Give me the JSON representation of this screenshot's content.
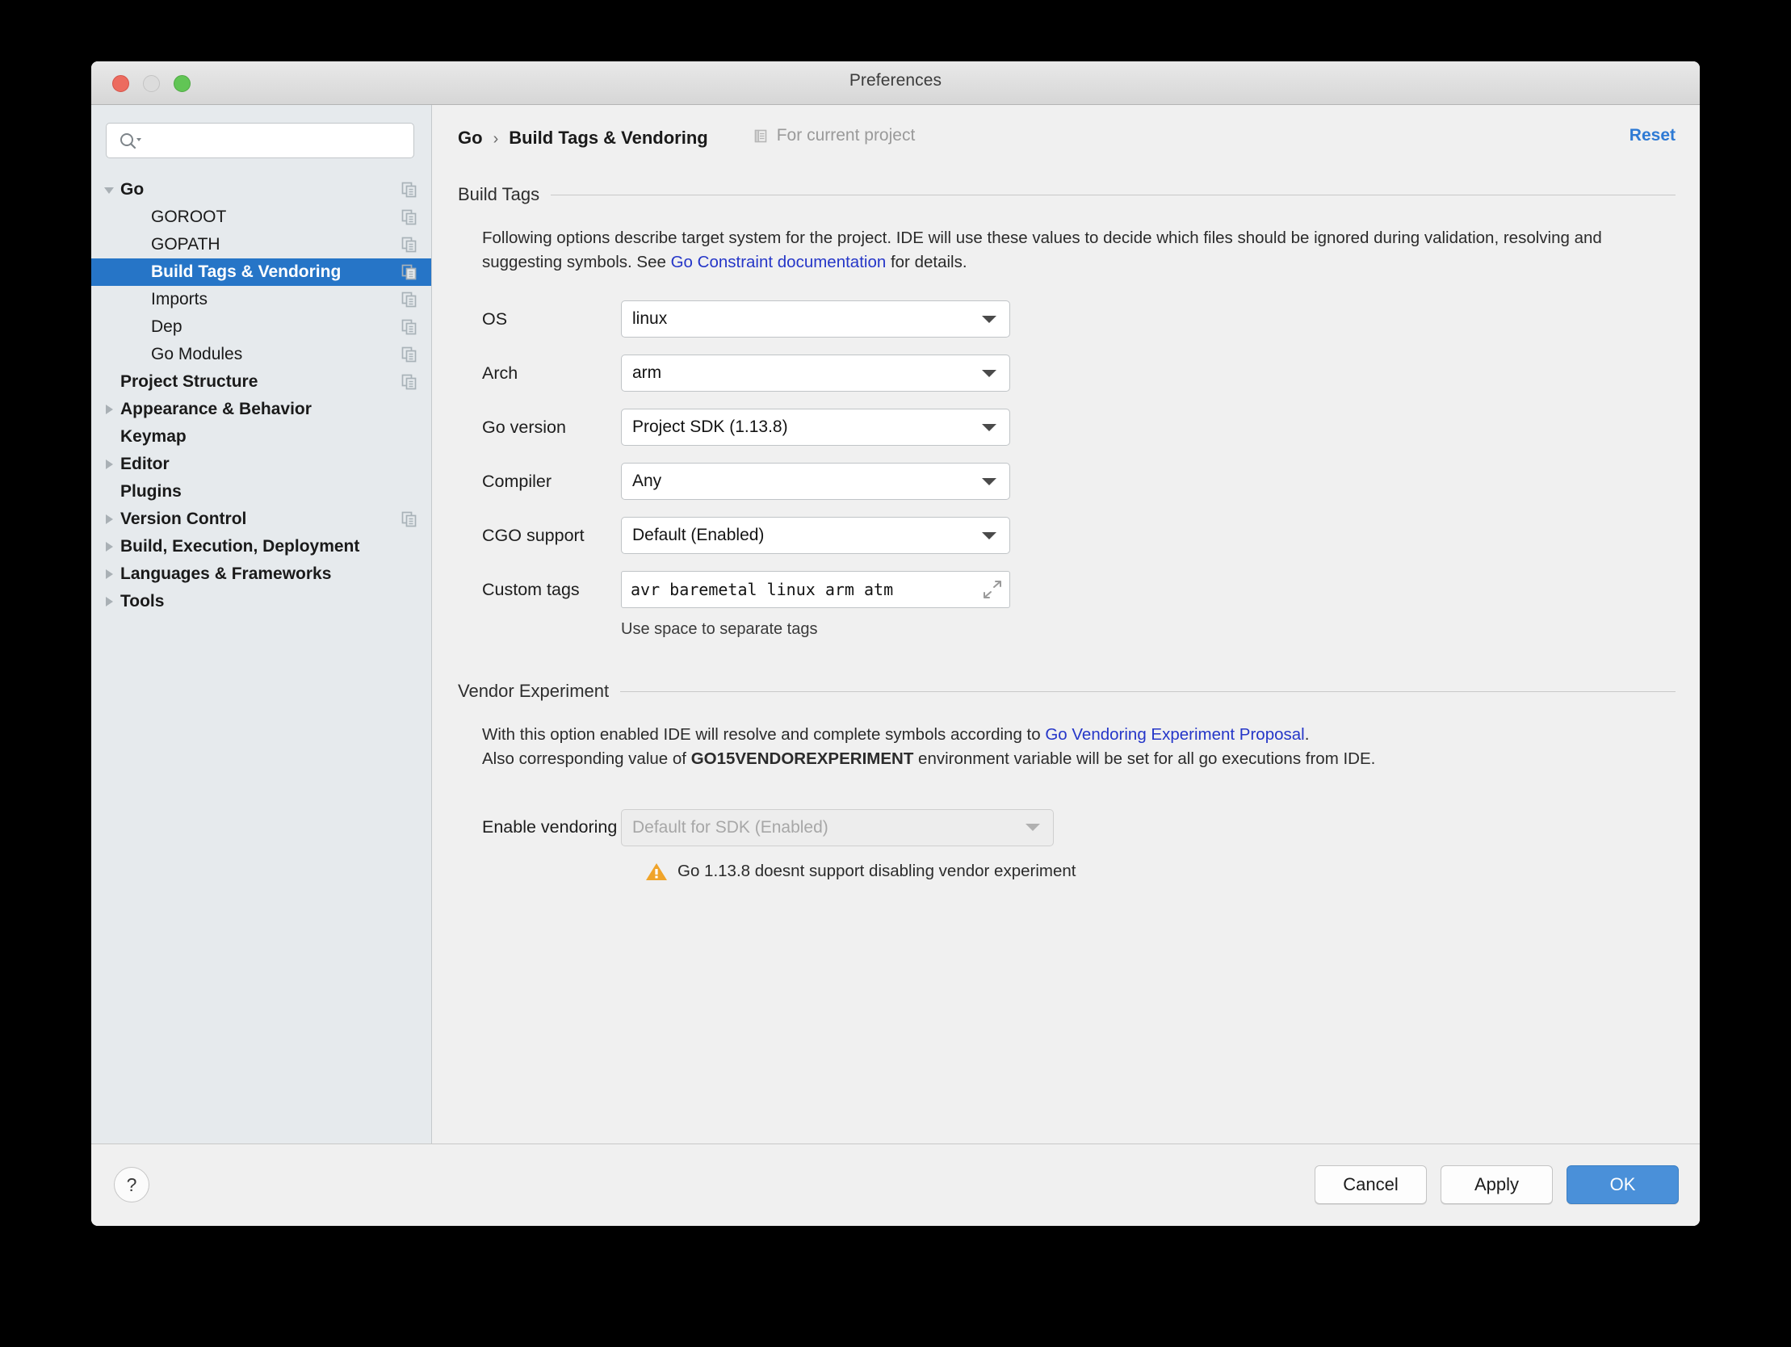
{
  "window": {
    "title": "Preferences",
    "traffic_lights": [
      "close",
      "minimize",
      "zoom"
    ]
  },
  "sidebar": {
    "search": {
      "placeholder": "",
      "value": "",
      "icon": "search-icon"
    },
    "items": [
      {
        "label": "Go",
        "level": 0,
        "bold": true,
        "twisty": "down",
        "selected": false,
        "copy_icon": true
      },
      {
        "label": "GOROOT",
        "level": 1,
        "bold": false,
        "twisty": "none",
        "selected": false,
        "copy_icon": true
      },
      {
        "label": "GOPATH",
        "level": 1,
        "bold": false,
        "twisty": "none",
        "selected": false,
        "copy_icon": true
      },
      {
        "label": "Build Tags & Vendoring",
        "level": 1,
        "bold": true,
        "twisty": "none",
        "selected": true,
        "copy_icon": true
      },
      {
        "label": "Imports",
        "level": 1,
        "bold": false,
        "twisty": "none",
        "selected": false,
        "copy_icon": true
      },
      {
        "label": "Dep",
        "level": 1,
        "bold": false,
        "twisty": "none",
        "selected": false,
        "copy_icon": true
      },
      {
        "label": "Go Modules",
        "level": 1,
        "bold": false,
        "twisty": "none",
        "selected": false,
        "copy_icon": true
      },
      {
        "label": "Project Structure",
        "level": 0,
        "bold": true,
        "twisty": "none",
        "selected": false,
        "copy_icon": true
      },
      {
        "label": "Appearance & Behavior",
        "level": 0,
        "bold": true,
        "twisty": "right",
        "selected": false,
        "copy_icon": false
      },
      {
        "label": "Keymap",
        "level": 0,
        "bold": true,
        "twisty": "none",
        "selected": false,
        "copy_icon": false
      },
      {
        "label": "Editor",
        "level": 0,
        "bold": true,
        "twisty": "right",
        "selected": false,
        "copy_icon": false
      },
      {
        "label": "Plugins",
        "level": 0,
        "bold": true,
        "twisty": "none",
        "selected": false,
        "copy_icon": false
      },
      {
        "label": "Version Control",
        "level": 0,
        "bold": true,
        "twisty": "right",
        "selected": false,
        "copy_icon": true
      },
      {
        "label": "Build, Execution, Deployment",
        "level": 0,
        "bold": true,
        "twisty": "right",
        "selected": false,
        "copy_icon": false
      },
      {
        "label": "Languages & Frameworks",
        "level": 0,
        "bold": true,
        "twisty": "right",
        "selected": false,
        "copy_icon": false
      },
      {
        "label": "Tools",
        "level": 0,
        "bold": true,
        "twisty": "right",
        "selected": false,
        "copy_icon": false
      }
    ]
  },
  "header": {
    "crumb_root": "Go",
    "crumb_separator": "›",
    "crumb_current": "Build Tags & Vendoring",
    "scope_label": "For current project",
    "scope_icon": "project-scope-icon",
    "reset_label": "Reset"
  },
  "build_tags": {
    "section_title": "Build Tags",
    "desc_part1": "Following options describe target system for the project. IDE will use these values to decide which files should be ignored during validation, resolving and suggesting symbols. See ",
    "desc_link": "Go Constraint documentation",
    "desc_part2": " for details.",
    "fields": [
      {
        "label": "OS",
        "value": "linux",
        "type": "combo",
        "disabled": false
      },
      {
        "label": "Arch",
        "value": "arm",
        "type": "combo",
        "disabled": false
      },
      {
        "label": "Go version",
        "value": "Project SDK (1.13.8)",
        "type": "combo",
        "disabled": false
      },
      {
        "label": "Compiler",
        "value": "Any",
        "type": "combo",
        "disabled": false
      },
      {
        "label": "CGO support",
        "value": "Default (Enabled)",
        "type": "combo",
        "disabled": false
      },
      {
        "label": "Custom tags",
        "value": "avr baremetal linux arm atm",
        "type": "text",
        "disabled": false,
        "expand_icon": "expand-diagonal-icon"
      }
    ],
    "hint": "Use space to separate tags"
  },
  "vendor": {
    "section_title": "Vendor Experiment",
    "line1_part1": "With this option enabled IDE will resolve and complete symbols according to ",
    "line1_link": "Go Vendoring Experiment Proposal",
    "line1_part2": ".",
    "line2_part1": "Also corresponding value of ",
    "line2_bold": "GO15VENDOREXPERIMENT",
    "line2_part2": " environment variable will be set for all go executions from IDE.",
    "field_label": "Enable vendoring",
    "field_value": "Default for SDK (Enabled)",
    "field_disabled": true,
    "warning_icon": "warning-triangle-icon",
    "warning_text": "Go 1.13.8 doesnt support disabling vendor experiment"
  },
  "footer": {
    "help_label": "?",
    "cancel_label": "Cancel",
    "apply_label": "Apply",
    "ok_label": "OK"
  },
  "colors": {
    "selection_blue": "#2675c7",
    "link_blue": "#2536c8",
    "reset_blue": "#2e7ad4",
    "primary_button": "#4a90d9",
    "warning_amber": "#f0a42a",
    "sidebar_bg": "#e6eaed",
    "content_bg": "#f0f0f0"
  }
}
